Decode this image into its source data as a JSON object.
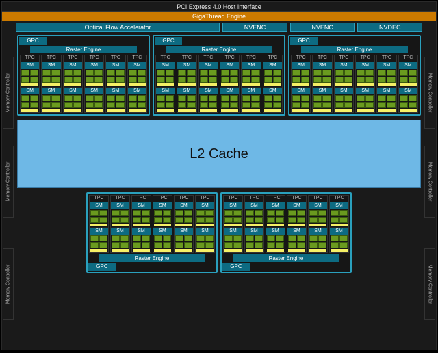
{
  "host_interface": "PCI Express 4.0 Host Interface",
  "gigathread": "GigaThread Engine",
  "engines": {
    "ofa": "Optical Flow Accelerator",
    "nvenc1": "NVENC",
    "nvenc2": "NVENC",
    "nvdec": "NVDEC"
  },
  "l2_label": "L2 Cache",
  "memory_controller_label": "Memory Controller",
  "gpc_label": "GPC",
  "raster_label": "Raster Engine",
  "tpc_label": "TPC",
  "sm_label": "SM",
  "architecture": {
    "gpc_count": 5,
    "tpc_per_gpc": 6,
    "sm_per_tpc": 2,
    "memory_controllers": 6,
    "nvenc_units": 2,
    "nvdec_units": 1,
    "ofa_units": 1
  },
  "colors": {
    "accent_teal": "#0d6b82",
    "accent_teal_border": "#2aa0bd",
    "orange": "#cc7a00",
    "l2_blue": "#6eb8e6",
    "core_green": "#6a9a1f",
    "core_yellow": "#f5f066",
    "bg": "#1a1a1a"
  }
}
